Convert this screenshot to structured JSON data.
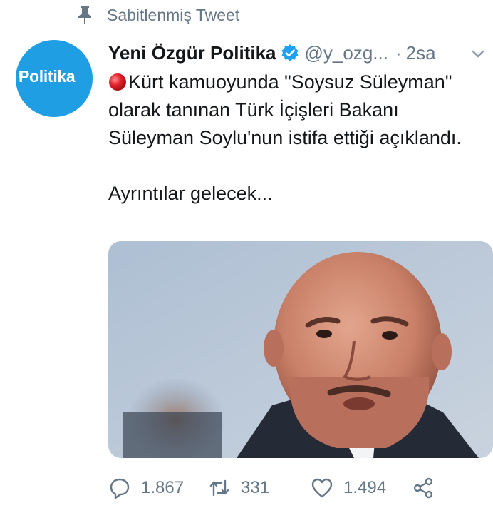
{
  "pinned": {
    "label": "Sabitlenmiş Tweet",
    "icon": "pin-icon"
  },
  "author": {
    "avatar_text": "Politika",
    "avatar_color": "#1f9ee3",
    "display_name": "Yeni Özgür Politika",
    "verified_icon": "verified-badge-icon",
    "handle": "@y_ozg...",
    "separator": "·",
    "time": "2sa"
  },
  "tweet": {
    "lead_icon": "red-circle-icon",
    "text": "Kürt kamuoyunda \"Soysuz Süleyman\" olarak tanınan Türk İçişleri Bakanı Süleyman Soylu'nun istifa ettiği açıklandı.\n\nAyrıntılar gelecek..."
  },
  "media": {
    "kind": "photo",
    "description_icon": "photo-icon"
  },
  "actions": {
    "reply_count": "1.867",
    "retweet_count": "331",
    "like_count": "1.494"
  },
  "colors": {
    "accent": "#1da1f2",
    "muted": "#657786",
    "text": "#14171a",
    "red_dot": "#e0245e"
  }
}
